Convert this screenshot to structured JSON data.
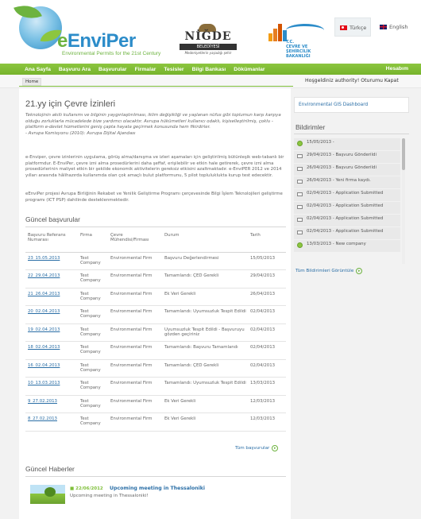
{
  "brand": {
    "logo_prefix": "e",
    "logo_env": "Envi",
    "logo_per": "Per",
    "tagline": "Environmental Permits for the 21st Century"
  },
  "partners": {
    "nigde_name": "NİĞDE",
    "nigde_sub": "BELEDİYESİ",
    "nigde_motto": "Medeniyetlerin yaşadığı şehir",
    "ministry_line1": "T.C.",
    "ministry_line2": "ÇEVRE VE ŞEHİRCİLİK",
    "ministry_line3": "BAKANLIĞI"
  },
  "languages": {
    "tr": "Türkçe",
    "en": "English"
  },
  "nav": {
    "items": [
      "Ana Sayfa",
      "Başvuru Ara",
      "Başvurular",
      "Firmalar",
      "Tesisler",
      "Bilgi Bankası",
      "Dökümanlar"
    ],
    "account": "Hesabım"
  },
  "subbar": {
    "home": "Home",
    "welcome": "Hoşgeldiniz authority! Oturumu Kapat"
  },
  "main": {
    "title": "21.yy için Çevre İzinleri",
    "quote": "Teknolojinin akıllı kullanımı ve bilginin yaygınlaştırılması, iklim değişikliği ve yaşlanan nüfus gibi toplumun karşı karşıya olduğu zorluklarla mücadelede bize yardımcı olacaktır. Avrupa hükümetleri kullanıcı odaklı, kişiselleştirilmiş, çoklu - platform e-devlet hizmetlerini geniş çapta hayata geçirmek konusunda hem fikirdirler.",
    "quote_source": "- Avrupa Komisyonu (2010): Avrupa Dijital Ajandası",
    "para1": "e-Enviper, çevre izinlerinin uygulama, görüş alma/danışma ve izleri aşamaları için geliştirilmiş bütünleşik web-tabanlı bir platformdur. E-EnviPer, çevre izni alma prosedürlerini daha şeffaf, erişilebilir ve etkin hale getirerek, çevre izni alma prosedürlerinin maliyet etkin bir şekilde ekonomik aktivitelerin gereksiz etkisini azaltmaktadır. e-EnviPER 2012 ve 2014 yılları arasında hâlihazırda kullanımda olan çok amaçlı bulut platformunu, 5 pilot topluluklukta kurup test edecektir.",
    "para2": "eEnviPer projesi Avrupa Birliğinin Rekabet ve Yenilik Geliştirme Programı çerçevesinde Bilgi İşlem Teknolojileri geliştirme programı (ICT PSP) dahilinde desteklenmektedir.",
    "apps_title": "Güncel başvurular",
    "columns": [
      "Başvuru Referans Numarası",
      "Firma",
      "Çevre Mühendisi/Firması",
      "Durum",
      "Tarih"
    ],
    "rows": [
      {
        "ref": "23_15.05.2013",
        "firm": "Test Company",
        "eng": "Environmental Firm",
        "status": "Başvuru Değerlendirmesi",
        "date": "15/05/2013"
      },
      {
        "ref": "22_29.04.2013",
        "firm": "Test Company",
        "eng": "Environmental Firm",
        "status": "Tamamlandı: ÇED Gerekli",
        "date": "29/04/2013"
      },
      {
        "ref": "21_26.04.2013",
        "firm": "Test Company",
        "eng": "Environmental Firm",
        "status": "Ek Veri Gerekli",
        "date": "26/04/2013"
      },
      {
        "ref": "20_02.04.2013",
        "firm": "Test Company",
        "eng": "Environmental Firm",
        "status": "Tamamlandı: Uyumsuzluk Tespit Edildi",
        "date": "02/04/2013"
      },
      {
        "ref": "19_02.04.2013",
        "firm": "Test Company",
        "eng": "Environmental Firm",
        "status": "Uyumsuzluk Tespit Edildi - Başvuruyu gözden geçiriniz",
        "date": "02/04/2013"
      },
      {
        "ref": "18_02.04.2013",
        "firm": "Test Company",
        "eng": "Environmental Firm",
        "status": "Tamamlandı: Başvuru Tamamlandı",
        "date": "02/04/2013"
      },
      {
        "ref": "16_02.04.2013",
        "firm": "Test Company",
        "eng": "Environmental Firm",
        "status": "Tamamlandı: ÇED Gerekli",
        "date": "02/04/2013"
      },
      {
        "ref": "10_13.03.2013",
        "firm": "Test Company",
        "eng": "Environmental Firm",
        "status": "Tamamlandı: Uyumsuzluk Tespit Edildi",
        "date": "13/03/2013"
      },
      {
        "ref": "9_27.02.2013",
        "firm": "Test Company",
        "eng": "Environmental Firm",
        "status": "Ek Veri Gerekli",
        "date": "12/03/2013"
      },
      {
        "ref": "8_27.02.2013",
        "firm": "Test Company",
        "eng": "Environmental Firm",
        "status": "Ek Veri Gerekli",
        "date": "12/03/2013"
      }
    ],
    "all_apps_link": "Tüm başvurular",
    "news_title": "Güncel Haberler",
    "news": {
      "date": "22/06/2012",
      "title": "Upcoming meeting in Thessaloniki",
      "desc": "Upcoming meeting in Thessaloniki!"
    }
  },
  "sidebar": {
    "gis_link": "Environmental GIS Dashboard",
    "notif_title": "Bildirimler",
    "notifications": [
      {
        "text": "15/05/2013 -",
        "icon": "check-circle-icon"
      },
      {
        "text": "29/04/2013 - Başvuru Gönderildi",
        "icon": "mail-icon"
      },
      {
        "text": "26/04/2013 - Başvuru Gönderildi",
        "icon": "mail-icon"
      },
      {
        "text": "26/04/2013 - Yeni firma kaydı.",
        "icon": "mail-icon"
      },
      {
        "text": "02/04/2013 - Application Submitted",
        "icon": "mail-icon"
      },
      {
        "text": "02/04/2013 - Application Submitted",
        "icon": "mail-icon"
      },
      {
        "text": "02/04/2013 - Application Submitted",
        "icon": "mail-icon"
      },
      {
        "text": "02/04/2013 - Application Submitted",
        "icon": "mail-icon"
      },
      {
        "text": "13/03/2013 - New company",
        "icon": "check-circle-icon"
      }
    ],
    "all_notif_link": "Tüm Bildirimleri Görüntüle"
  },
  "colors": {
    "nav_green": "#8cc63f",
    "link_blue": "#2a6ea6",
    "brand_blue": "#2c8cc9"
  }
}
